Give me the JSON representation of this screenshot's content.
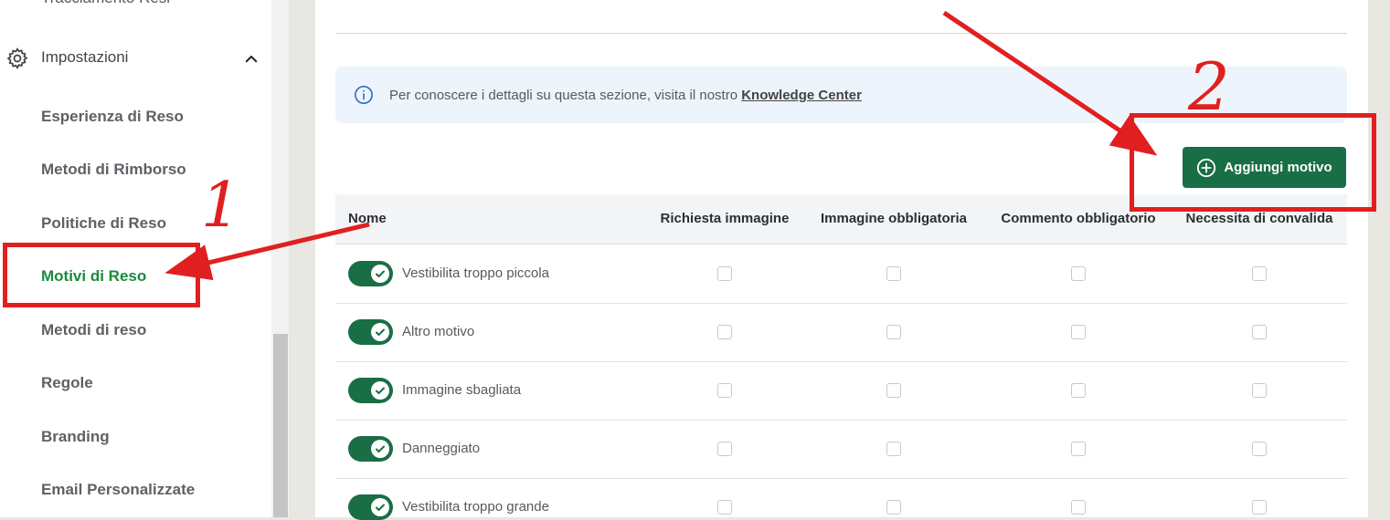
{
  "sidebar": {
    "top_item": "Tracciamento Resi",
    "section": {
      "label": "Impostazioni",
      "icon": "gear-icon",
      "expanded_icon": "chevron-up-icon"
    },
    "items": [
      {
        "label": "Esperienza di Reso"
      },
      {
        "label": "Metodi di Rimborso"
      },
      {
        "label": "Politiche di Reso"
      },
      {
        "label": "Motivi di Reso",
        "active": true
      },
      {
        "label": "Metodi di reso"
      },
      {
        "label": "Regole"
      },
      {
        "label": "Branding"
      },
      {
        "label": "Email Personalizzate"
      }
    ]
  },
  "info": {
    "text": "Per conoscere i dettagli su questa sezione, visita il nostro",
    "link": "Knowledge Center",
    "icon": "info-icon"
  },
  "add_button": {
    "label": "Aggiungi motivo",
    "icon": "plus-circle-icon"
  },
  "table": {
    "headers": [
      "Nome",
      "Richiesta immagine",
      "Immagine obbligatoria",
      "Commento obbligatorio",
      "Necessita di convalida"
    ],
    "rows": [
      {
        "name": "Vestibilita troppo piccola",
        "enabled": true
      },
      {
        "name": "Altro motivo",
        "enabled": true
      },
      {
        "name": "Immagine sbagliata",
        "enabled": true
      },
      {
        "name": "Danneggiato",
        "enabled": true
      },
      {
        "name": "Vestibilita troppo grande",
        "enabled": true
      }
    ]
  },
  "annotations": {
    "step1": "1",
    "step2": "2",
    "color": "#e02020"
  },
  "colors": {
    "accent": "#1a6e45",
    "active_nav": "#1a8a3c"
  }
}
